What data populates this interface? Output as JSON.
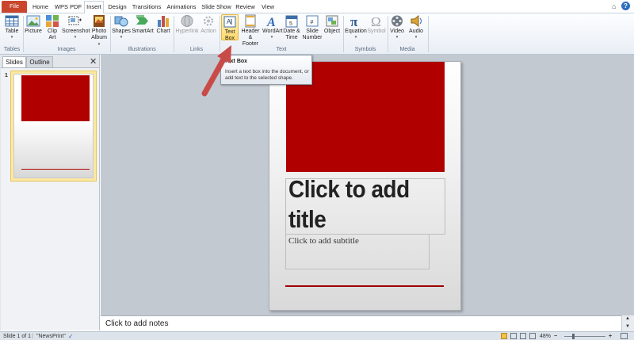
{
  "tabs": [
    "File",
    "Home",
    "WPS PDF",
    "Insert",
    "Design",
    "Transitions",
    "Animations",
    "Slide Show",
    "Review",
    "View"
  ],
  "active_tab": "Insert",
  "ribbon": {
    "table": {
      "label": "Table"
    },
    "picture": {
      "label": "Picture"
    },
    "clipart": {
      "label1": "Clip",
      "label2": "Art"
    },
    "screenshot": {
      "label": "Screenshot"
    },
    "photoalbum": {
      "label1": "Photo",
      "label2": "Album"
    },
    "shapes": {
      "label": "Shapes"
    },
    "smartart": {
      "label": "SmartArt"
    },
    "chart": {
      "label": "Chart"
    },
    "hyperlink": {
      "label": "Hyperlink"
    },
    "action": {
      "label": "Action"
    },
    "textbox": {
      "label1": "Text",
      "label2": "Box"
    },
    "headerfooter": {
      "label1": "Header",
      "label2": "& Footer"
    },
    "wordart": {
      "label": "WordArt"
    },
    "datetime": {
      "label1": "Date &",
      "label2": "Time"
    },
    "slidenumber": {
      "label1": "Slide",
      "label2": "Number"
    },
    "object": {
      "label": "Object"
    },
    "equation": {
      "label": "Equation"
    },
    "symbol": {
      "label": "Symbol"
    },
    "video": {
      "label": "Video"
    },
    "audio": {
      "label": "Audio"
    }
  },
  "groups": {
    "tables": "Tables",
    "images": "Images",
    "illustrations": "Illustrations",
    "links": "Links",
    "text": "Text",
    "symbols": "Symbols",
    "media": "Media"
  },
  "tooltip": {
    "title": "Text Box",
    "description": "Insert a text box into the document, or add text to the selected shape."
  },
  "panel": {
    "tab_slides": "Slides",
    "tab_outline": "Outline",
    "close_glyph": "✕",
    "slide_number": "1"
  },
  "slide": {
    "title": "Click to add title",
    "subtitle": "Click to add subtitle"
  },
  "notes": {
    "placeholder": "Click to add notes"
  },
  "status": {
    "slide_info": "Slide 1 of 1",
    "theme": "\"NewsPrint\"",
    "zoom": "48%"
  },
  "colors": {
    "accent_red": "#b00000",
    "file_tab": "#c9452b",
    "annotation_arrow": "#c84b47"
  },
  "icons": {
    "help": "?",
    "minimize_ribbon": "⌂"
  }
}
